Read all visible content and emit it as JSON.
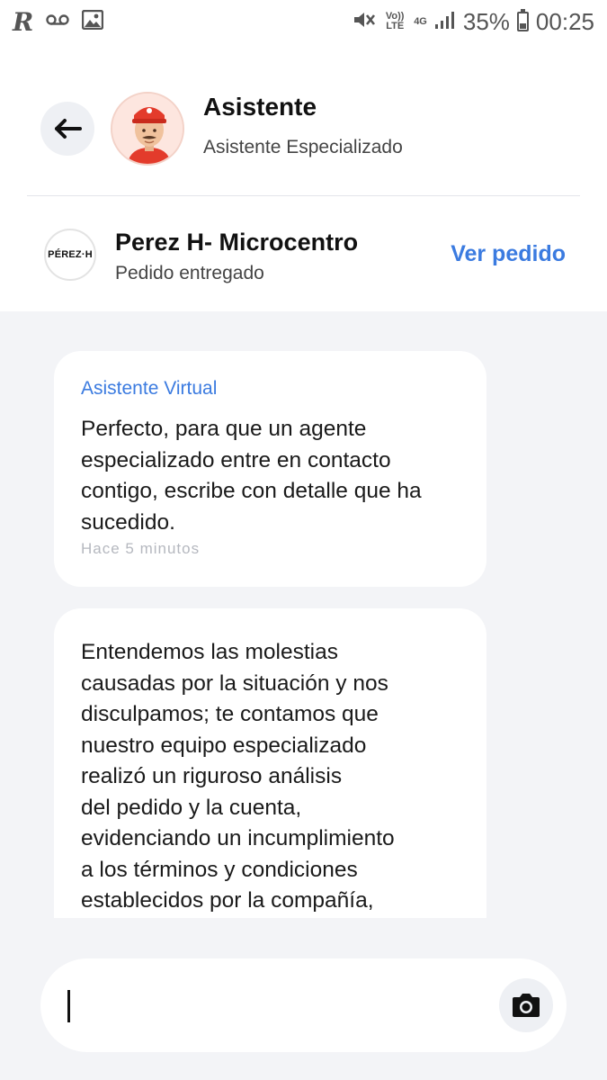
{
  "status_bar": {
    "battery": "35%",
    "time": "00:25",
    "volte_label": "Vo)) LTE",
    "network": "4G",
    "icons": [
      "app-r-icon",
      "voicemail-icon",
      "gallery-icon",
      "mute-icon",
      "volte-icon",
      "network-4g-icon",
      "signal-icon",
      "battery-icon"
    ]
  },
  "header": {
    "title": "Asistente",
    "subtitle": "Asistente Especializado"
  },
  "store": {
    "logo_text": "PÉREZ·H",
    "name": "Perez H- Microcentro",
    "status": "Pedido entregado",
    "link": "Ver pedido"
  },
  "messages": [
    {
      "sender": "Asistente Virtual",
      "text": "Perfecto, para que un agente especializado entre en contacto contigo, escribe con detalle que ha sucedido.",
      "time": "Hace 5 minutos"
    },
    {
      "text_lines": [
        "Entendemos las molestias",
        "causadas por la situación y nos",
        "disculpamos; te contamos que",
        "nuestro equipo especializado",
        "realizó un riguroso análisis",
        "del pedido y la cuenta,",
        "evidenciando un incumplimiento",
        "a los términos y condiciones",
        "establecidos por la compañía,"
      ]
    }
  ],
  "input": {
    "value": ""
  },
  "colors": {
    "accent": "#3b7be0",
    "chat_bg": "#f3f4f7"
  }
}
